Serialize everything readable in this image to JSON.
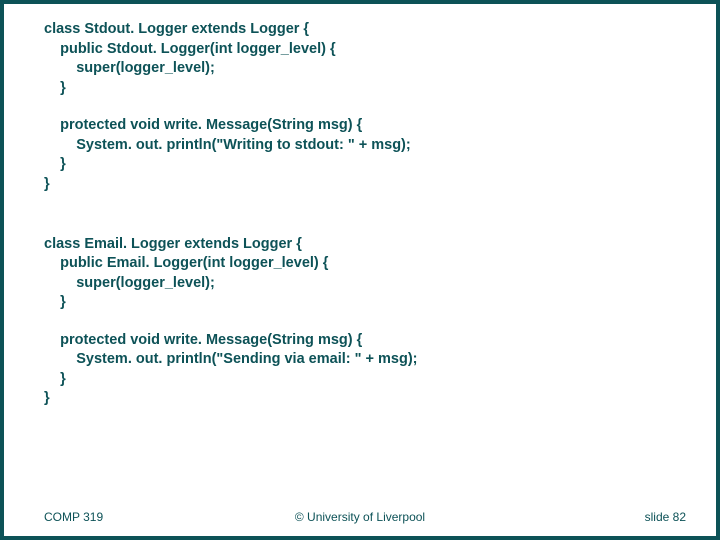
{
  "code": {
    "l1": "class Stdout. Logger extends Logger {",
    "l2": "    public Stdout. Logger(int logger_level) {",
    "l3": "        super(logger_level);",
    "l4": "    }",
    "l5": "    protected void write. Message(String msg) {",
    "l6": "        System. out. println(\"Writing to stdout: \" + msg);",
    "l7": "    }",
    "l8": "}",
    "l9": "class Email. Logger extends Logger {",
    "l10": "    public Email. Logger(int logger_level) {",
    "l11": "        super(logger_level);",
    "l12": "    }",
    "l13": "    protected void write. Message(String msg) {",
    "l14": "        System. out. println(\"Sending via email: \" + msg);",
    "l15": "    }",
    "l16": "}"
  },
  "footer": {
    "course": "COMP 319",
    "copyright": "© University of Liverpool",
    "slide": "slide  82"
  }
}
